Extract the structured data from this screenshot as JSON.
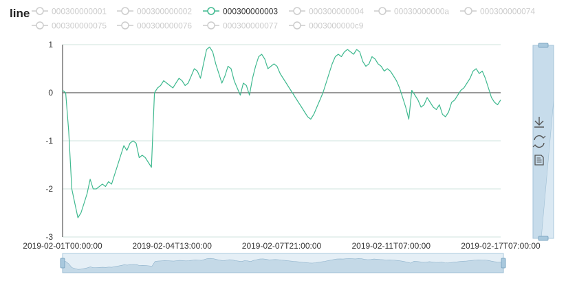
{
  "chart_data": {
    "type": "line",
    "title": "line",
    "legend": {
      "placement": "top",
      "selected": "000300000003",
      "items": [
        "000300000001",
        "000300000002",
        "000300000003",
        "000300000004",
        "00030000000a",
        "000300000074",
        "000300000075",
        "000300000076",
        "000300000077",
        "0003000000c9"
      ]
    },
    "x_tick_labels": [
      "2019-02-01T00:00:00",
      "2019-02-04T13:00:00",
      "2019-02-07T21:00:00",
      "2019-02-11T07:00:00",
      "2019-02-17T07:00:00"
    ],
    "ylim": [
      -3,
      1
    ],
    "y_ticks": [
      1,
      0,
      -1,
      -2,
      -3
    ],
    "grid": true,
    "series": [
      {
        "name": "000300000003",
        "color": "#3fb98f",
        "values": [
          0.05,
          0.0,
          -0.8,
          -2.0,
          -2.3,
          -2.6,
          -2.5,
          -2.3,
          -2.1,
          -1.8,
          -2.0,
          -2.0,
          -1.95,
          -1.9,
          -1.95,
          -1.85,
          -1.9,
          -1.7,
          -1.5,
          -1.3,
          -1.1,
          -1.2,
          -1.05,
          -1.0,
          -1.05,
          -1.35,
          -1.3,
          -1.35,
          -1.45,
          -1.55,
          0.0,
          0.1,
          0.15,
          0.25,
          0.2,
          0.15,
          0.1,
          0.2,
          0.3,
          0.25,
          0.15,
          0.2,
          0.35,
          0.5,
          0.45,
          0.3,
          0.6,
          0.9,
          0.95,
          0.85,
          0.6,
          0.4,
          0.2,
          0.35,
          0.55,
          0.5,
          0.25,
          0.1,
          -0.05,
          0.2,
          0.15,
          -0.05,
          0.3,
          0.55,
          0.75,
          0.8,
          0.7,
          0.5,
          0.55,
          0.6,
          0.55,
          0.4,
          0.3,
          0.2,
          0.1,
          0.0,
          -0.1,
          -0.2,
          -0.3,
          -0.4,
          -0.5,
          -0.55,
          -0.45,
          -0.3,
          -0.15,
          0.0,
          0.2,
          0.4,
          0.6,
          0.75,
          0.8,
          0.75,
          0.85,
          0.9,
          0.85,
          0.8,
          0.9,
          0.85,
          0.65,
          0.55,
          0.6,
          0.75,
          0.7,
          0.6,
          0.55,
          0.45,
          0.5,
          0.45,
          0.35,
          0.25,
          0.1,
          -0.1,
          -0.3,
          -0.55,
          0.05,
          -0.05,
          -0.15,
          -0.3,
          -0.25,
          -0.1,
          -0.2,
          -0.3,
          -0.35,
          -0.25,
          -0.45,
          -0.5,
          -0.4,
          -0.2,
          -0.15,
          -0.05,
          0.05,
          0.1,
          0.2,
          0.3,
          0.45,
          0.5,
          0.4,
          0.45,
          0.3,
          0.1,
          -0.1,
          -0.2,
          -0.25,
          -0.15
        ]
      }
    ]
  },
  "toolbar": {
    "tools": [
      "download-icon",
      "restore-icon",
      "data-view-icon"
    ]
  },
  "colors": {
    "line": "#3fb98f",
    "legend_inactive": "#cccccc",
    "legend_active_text": "#333333",
    "zoom_fill": "#cfe2ef",
    "zoom_border": "#a8c8dd",
    "grid": "#cfe3dc"
  }
}
